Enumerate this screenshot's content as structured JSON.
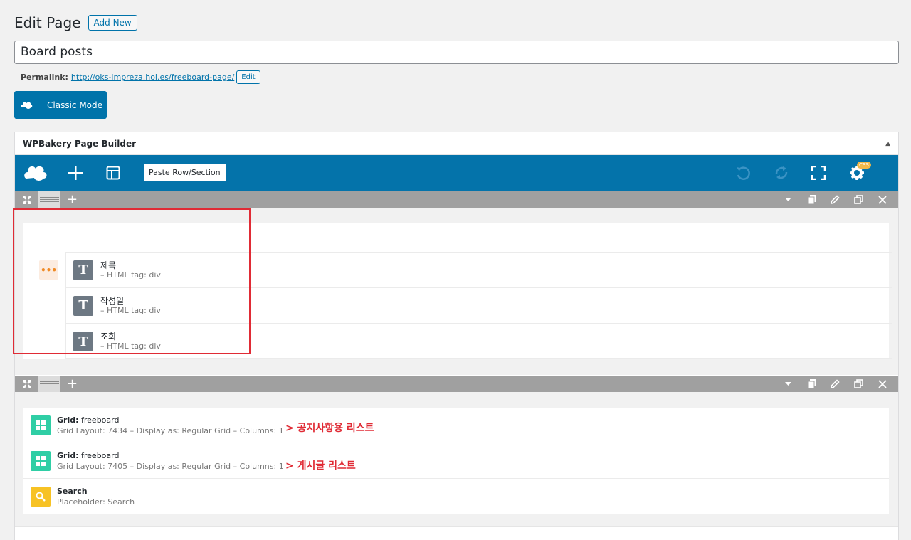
{
  "header": {
    "title": "Edit Page",
    "add_new": "Add New"
  },
  "post_title": "Board posts",
  "permalink": {
    "label": "Permalink:",
    "url": "http://oks-impreza.hol.es/freeboard-page/",
    "edit": "Edit"
  },
  "classic_mode": "Classic Mode",
  "builder": {
    "title": "WPBakery Page Builder",
    "paste_label": "Paste Row/Section",
    "css_badge": "CSS"
  },
  "row1": {
    "elements": [
      {
        "name": "제목",
        "sub": "– HTML tag: div",
        "icon": "text-block-icon"
      },
      {
        "name": "작성일",
        "sub": "– HTML tag: div",
        "icon": "text-block-icon"
      },
      {
        "name": "조회",
        "sub": "– HTML tag: div",
        "icon": "text-block-icon"
      }
    ]
  },
  "row2": {
    "elements": [
      {
        "label": "Grid:",
        "value": "freeboard",
        "sub": "Grid Layout: 7434  –  Display as: Regular Grid  –  Columns: 1",
        "note": "> 공지사항용 리스트",
        "icon": "grid-icon"
      },
      {
        "label": "Grid:",
        "value": "freeboard",
        "sub": "Grid Layout: 7405  –  Display as: Regular Grid  –  Columns: 1",
        "note": "> 게시글 리스트",
        "icon": "grid-icon"
      },
      {
        "label": "Search",
        "value": "",
        "sub": "Placeholder: Search",
        "note": "",
        "icon": "search-icon"
      }
    ]
  },
  "colors": {
    "primary": "#0073aa",
    "toolbar": "#0473aa",
    "annotation": "#e02b35",
    "grid_icon": "#2fcea5",
    "search_icon": "#f7c224"
  }
}
